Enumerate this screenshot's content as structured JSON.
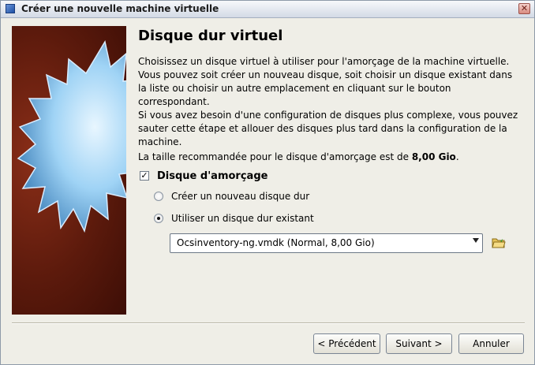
{
  "window": {
    "title": "Créer une nouvelle machine virtuelle"
  },
  "page": {
    "heading": "Disque dur virtuel",
    "paragraph1": "Choisissez un disque virtuel à utiliser pour l'amorçage de la machine virtuelle. Vous pouvez soit créer un nouveau disque, soit choisir un disque existant dans la liste ou choisir un autre emplacement en cliquant sur le bouton correspondant.",
    "paragraph2": "Si vous avez besoin d'une configuration de disques plus complexe, vous pouvez sauter cette étape et allouer des disques plus tard dans la configuration de la machine.",
    "paragraph3_prefix": "La taille recommandée pour le disque d'amorçage est de ",
    "recommended_size": "8,00 Gio",
    "paragraph3_suffix": "."
  },
  "boot_disk": {
    "label": "Disque d'amorçage",
    "checked": true,
    "options": [
      {
        "label": "Créer un nouveau disque dur",
        "selected": false
      },
      {
        "label": "Utiliser un disque dur existant",
        "selected": true
      }
    ],
    "selected_disk": "Ocsinventory-ng.vmdk (Normal, 8,00 Gio)",
    "browse_icon": "folder-open-icon"
  },
  "buttons": {
    "back": "< Précédent",
    "next": "Suivant >",
    "cancel": "Annuler"
  },
  "colors": {
    "banner_red": "#5c1a0c",
    "star_blue": "#9fd3f5"
  }
}
